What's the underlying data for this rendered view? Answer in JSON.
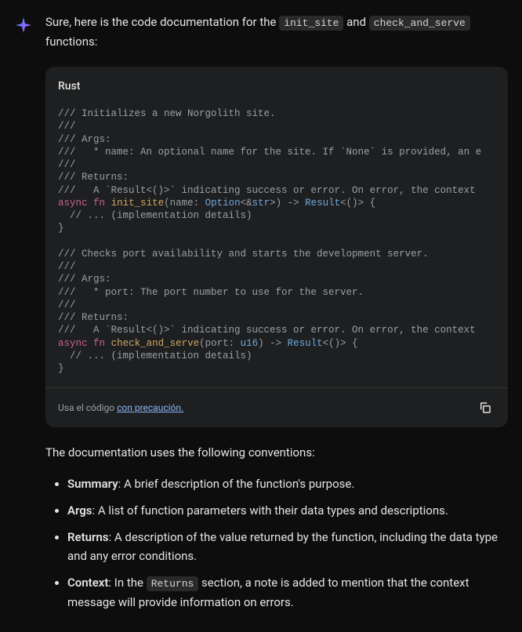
{
  "intro": {
    "text_before_code1": "Sure, here is the code documentation for the ",
    "code1": "init_site",
    "text_between": " and ",
    "code2": "check_and_serve",
    "text_after": " functions:"
  },
  "code_block": {
    "language": "Rust",
    "footer_text": "Usa el código ",
    "footer_link": "con precaución.",
    "lines": {
      "c1": "/// Initializes a new Norgolith site.",
      "c2": "///",
      "c3": "/// Args:",
      "c4": "///   * name: An optional name for the site. If `None` is provided, an e",
      "c5": "///",
      "c6": "/// Returns:",
      "c7": "///   A `Result<()>` indicating success or error. On error, the context",
      "kw_async": "async",
      "kw_fn": "fn",
      "fn1_name": "init_site",
      "fn1_p1": "(name: ",
      "fn1_type1": "Option",
      "fn1_p2": "<&",
      "fn1_type2": "str",
      "fn1_p3": ">) -> ",
      "fn1_type3": "Result",
      "fn1_p4": "<()> {",
      "impl_comment": "  // ... (implementation details)",
      "brace_close": "}",
      "c8": "/// Checks port availability and starts the development server.",
      "c9": "///",
      "c10": "/// Args:",
      "c11": "///   * port: The port number to use for the server.",
      "c12": "///",
      "c13": "/// Returns:",
      "c14": "///   A `Result<()>` indicating success or error. On error, the context",
      "fn2_name": "check_and_serve",
      "fn2_p1": "(port: ",
      "fn2_type1": "u16",
      "fn2_p2": ") -> ",
      "fn2_type2": "Result",
      "fn2_p3": "<()> {"
    }
  },
  "conventions": {
    "intro": "The documentation uses the following conventions:",
    "items": [
      {
        "title": "Summary",
        "desc": ": A brief description of the function's purpose."
      },
      {
        "title": "Args",
        "desc": ": A list of function parameters with their data types and descriptions."
      },
      {
        "title": "Returns",
        "desc": ": A description of the value returned by the function, including the data type and any error conditions."
      },
      {
        "title": "Context",
        "desc_before": ": In the ",
        "code": "Returns",
        "desc_after": " section, a note is added to mention that the context message will provide information on errors."
      }
    ]
  }
}
